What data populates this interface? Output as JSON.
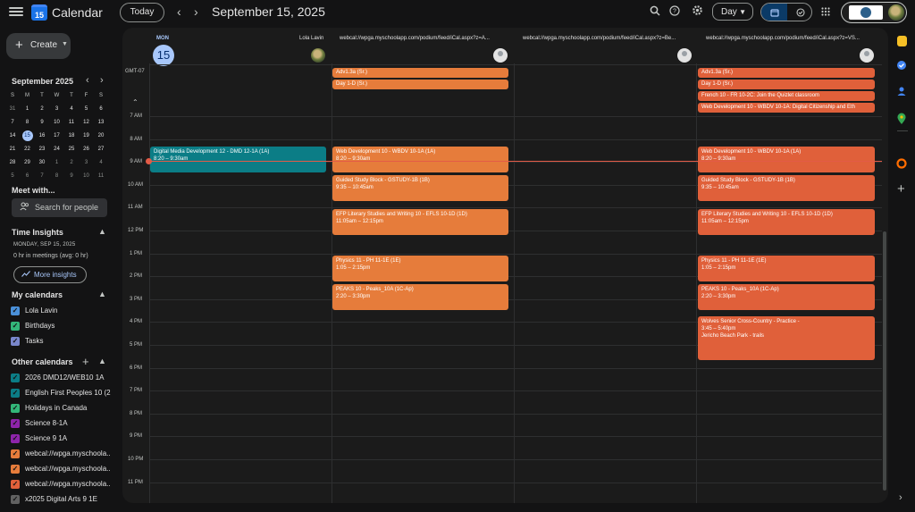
{
  "header": {
    "app_title": "Calendar",
    "logo_day": "15",
    "today_label": "Today",
    "prev_icon": "‹",
    "next_icon": "›",
    "date_title": "September 15, 2025",
    "view_label": "Day"
  },
  "sidebar": {
    "create_label": "Create",
    "mini_cal": {
      "title": "September 2025",
      "weekdays": [
        "S",
        "M",
        "T",
        "W",
        "T",
        "F",
        "S"
      ],
      "weeks": [
        [
          "31",
          "1",
          "2",
          "3",
          "4",
          "5",
          "6"
        ],
        [
          "7",
          "8",
          "9",
          "10",
          "11",
          "12",
          "13"
        ],
        [
          "14",
          "15",
          "16",
          "17",
          "18",
          "19",
          "20"
        ],
        [
          "21",
          "22",
          "23",
          "24",
          "25",
          "26",
          "27"
        ],
        [
          "28",
          "29",
          "30",
          "1",
          "2",
          "3",
          "4"
        ],
        [
          "5",
          "6",
          "7",
          "8",
          "9",
          "10",
          "11"
        ]
      ],
      "selected": "15"
    },
    "meet_with": "Meet with...",
    "search_people": "Search for people",
    "time_insights": "Time Insights",
    "ti_date": "MONDAY, SEP 15, 2025",
    "ti_stat": "0 hr in meetings (avg: 0 hr)",
    "more_insights": "More insights",
    "my_calendars_title": "My calendars",
    "my_calendars": [
      {
        "name": "Lola Lavin",
        "color": "#4a90d9"
      },
      {
        "name": "Birthdays",
        "color": "#33b679"
      },
      {
        "name": "Tasks",
        "color": "#7986cb"
      }
    ],
    "other_calendars_title": "Other calendars",
    "other_calendars": [
      {
        "name": "2026 DMD12/WEB10 1A",
        "color": "#0b7d86"
      },
      {
        "name": "English First Peoples 10 (2...",
        "color": "#0b7d86"
      },
      {
        "name": "Holidays in Canada",
        "color": "#33b679"
      },
      {
        "name": "Science 8-1A",
        "color": "#8e24aa"
      },
      {
        "name": "Science 9 1A",
        "color": "#8e24aa"
      },
      {
        "name": "webcal://wpga.myschoola...",
        "color": "#e67c3b"
      },
      {
        "name": "webcal://wpga.myschoola...",
        "color": "#e67c3b"
      },
      {
        "name": "webcal://wpga.myschoola...",
        "color": "#e0603a"
      },
      {
        "name": "x2025 Digital Arts 9 1E",
        "color": "#616161"
      }
    ]
  },
  "day_header": {
    "dow": "MON",
    "day": "15",
    "gmt": "GMT-07",
    "columns": [
      "Lola Lavin",
      "webcal://wpga.myschoolapp.com/podium/feed/iCal.aspx?z=A...",
      "webcal://wpga.myschoolapp.com/podium/feed/iCal.aspx?z=Be...",
      "webcal://wpga.myschoolapp.com/podium/feed/iCal.aspx?z=VS..."
    ]
  },
  "hours": [
    "7 AM",
    "8 AM",
    "9 AM",
    "10 AM",
    "11 AM",
    "12 PM",
    "1 PM",
    "2 PM",
    "3 PM",
    "4 PM",
    "5 PM",
    "6 PM",
    "7 PM",
    "8 PM",
    "9 PM",
    "10 PM",
    "11 PM"
  ],
  "allday": {
    "col2": [
      "Adv1.3a (Sr.)",
      "Day 1-D (Sr.)"
    ],
    "col4": [
      "Adv1.3a (Sr.)",
      "Day 1-D (Sr.)",
      "French 10 - FR 10-2C: Join the Quizlet classroom",
      "Web Development 10 - WBDV 10-1A: Digital Citizenship and Eth"
    ]
  },
  "events": {
    "col1": [
      {
        "title": "Digital Media Development 12 - DMD 12-1A (1A)",
        "time": "8:20 – 9:30am"
      }
    ],
    "col2": [
      {
        "title": "Web Development 10 - WBDV 10-1A (1A)",
        "time": "8:20 – 9:30am"
      },
      {
        "title": "Guided Study Block - GSTUDY-1B (1B)",
        "time": "9:35 – 10:45am"
      },
      {
        "title": "EFP Literary Studies and Writing 10 - EFLS 10-1D (1D)",
        "time": "11:05am – 12:15pm"
      },
      {
        "title": "Physics 11 - PH 11-1E (1E)",
        "time": "1:05 – 2:15pm"
      },
      {
        "title": "PEAKS 10 - Peaks_10A (1C-Ap)",
        "time": "2:20 – 3:30pm"
      }
    ],
    "col4": [
      {
        "title": "Web Development 10 - WBDV 10-1A (1A)",
        "time": "8:20 – 9:30am"
      },
      {
        "title": "Guided Study Block - GSTUDY-1B (1B)",
        "time": "9:35 – 10:45am"
      },
      {
        "title": "EFP Literary Studies and Writing 10 - EFLS 10-1D (1D)",
        "time": "11:05am – 12:15pm"
      },
      {
        "title": "Physics 11 - PH 11-1E (1E)",
        "time": "1:05 – 2:15pm"
      },
      {
        "title": "PEAKS 10 - Peaks_10A (1C-Ap)",
        "time": "2:20 – 3:30pm"
      },
      {
        "title": "Wolves Senior Cross-Country - Practice -",
        "time": "3:45 – 5:40pm",
        "location": "Jericho Beach Park - trails"
      }
    ]
  }
}
